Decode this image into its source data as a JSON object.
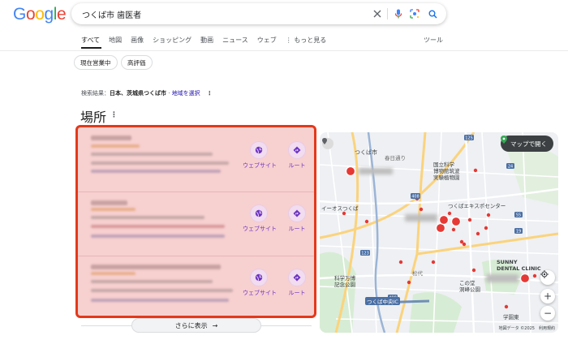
{
  "header": {
    "logo": [
      "G",
      "o",
      "o",
      "g",
      "l",
      "e"
    ],
    "logo_colors": [
      "#4285F4",
      "#EA4335",
      "#FBBC05",
      "#4285F4",
      "#34A853",
      "#EA4335"
    ],
    "query": "つくば市 歯医者"
  },
  "tabs": [
    "すべて",
    "地図",
    "画像",
    "ショッピング",
    "動画",
    "ニュース",
    "ウェブ",
    "もっと見る"
  ],
  "tools_label": "ツール",
  "chips": [
    "現在営業中",
    "高評価"
  ],
  "results_info": {
    "prefix": "検索結果：",
    "location": "日本、茨城県つくば市",
    "sep": " · ",
    "link": "地域を選択"
  },
  "places": {
    "title": "場所",
    "listings": [
      {
        "website_label": "ウェブサイト",
        "route_label": "ルート"
      },
      {
        "website_label": "ウェブサイト",
        "route_label": "ルート"
      },
      {
        "website_label": "ウェブサイト",
        "route_label": "ルート"
      }
    ],
    "more_label": "さらに表示"
  },
  "map": {
    "open_label": "マップで開く",
    "labels": {
      "tsukuba_city": "つくば市",
      "kasuga": "春日通り",
      "museum": "国立科学\n博物館筑波\n実験植物園",
      "aeon": "イーオスつくば",
      "expo_center": "つくばエキスポセンター",
      "fuzoku": "科学万博\n記念公園",
      "matsushiro": "松代",
      "dokan": "この堂\n洞峰公園",
      "sunny": "SUNNY\nDENTAL CLINIC",
      "tsukuba_chuo": "つくば中央IC",
      "gakuen": "学園東",
      "copyright": "地図データ ©2025　利用規約"
    },
    "roads": [
      "125",
      "408",
      "123",
      "55",
      "24",
      "19",
      "408"
    ]
  },
  "colors": {
    "highlight_border": "#e3391b",
    "highlight_fill": "#f7d0d0",
    "action_text": "#6d35c2"
  }
}
